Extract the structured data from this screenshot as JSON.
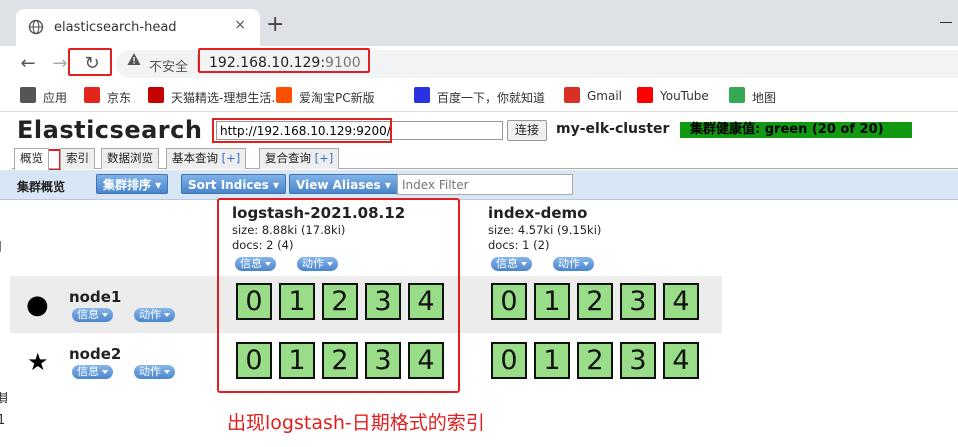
{
  "browser": {
    "tab_title": "elasticsearch-head",
    "tab_close": "×",
    "new_tab": "+",
    "back": "←",
    "forward": "→",
    "reload": "↻",
    "insecure_label": "不安全",
    "url_host": "192.168.10.129:",
    "url_port": "9100",
    "bookmarks": [
      {
        "label": "应用",
        "icon": "apps-grid-icon",
        "color": "#555555"
      },
      {
        "label": "京东",
        "icon": "jd-icon",
        "color": "#e1251b"
      },
      {
        "label": "天猫精选-理想生活...",
        "icon": "tmall-icon",
        "color": "#c40000"
      },
      {
        "label": "爱淘宝PC新版",
        "icon": "taobao-icon",
        "color": "#ff5000"
      },
      {
        "label": "百度一下，你就知道",
        "icon": "baidu-icon",
        "color": "#2932e1"
      },
      {
        "label": "Gmail",
        "icon": "gmail-icon",
        "color": "#d93025"
      },
      {
        "label": "YouTube",
        "icon": "youtube-icon",
        "color": "#ff0000"
      },
      {
        "label": "地图",
        "icon": "maps-icon",
        "color": "#34a853"
      }
    ]
  },
  "es": {
    "title": "Elasticsearch",
    "connect_url": "http://192.168.10.129:9200/",
    "connect_button": "连接",
    "cluster_name": "my-elk-cluster",
    "health": "集群健康值: green (20 of 20)",
    "health_color": "#119911",
    "tabs": [
      {
        "label": "概览",
        "plus": ""
      },
      {
        "label": "索引",
        "plus": ""
      },
      {
        "label": "数据浏览",
        "plus": ""
      },
      {
        "label": "基本查询",
        "plus": "[+]"
      },
      {
        "label": "复合查询",
        "plus": "[+]"
      }
    ],
    "toolbar": {
      "overview_label": "集群概览",
      "sort_cluster": "集群排序",
      "sort_indices": "Sort Indices",
      "view_aliases": "View Aliases",
      "index_filter_placeholder": "Index Filter"
    },
    "indices": [
      {
        "name": "logstash-2021.08.12",
        "size": "size: 8.88ki (17.8ki)",
        "docs": "docs: 2 (4)",
        "info": "信息",
        "action": "动作"
      },
      {
        "name": "index-demo",
        "size": "size: 4.57ki (9.15ki)",
        "docs": "docs: 1 (2)",
        "info": "信息",
        "action": "动作"
      }
    ],
    "nodes": [
      {
        "name": "node1",
        "icon": "circle-master-icon",
        "symbol": "●",
        "info": "信息",
        "action": "动作",
        "shards": [
          "0",
          "1",
          "2",
          "3",
          "4"
        ]
      },
      {
        "name": "node2",
        "icon": "star-node-icon",
        "symbol": "★",
        "info": "信息",
        "action": "动作",
        "shards": [
          "0",
          "1",
          "2",
          "3",
          "4"
        ]
      }
    ],
    "shard_color": "#99dd88"
  },
  "annotation": {
    "caption": "出现logstash-日期格式的索引"
  },
  "left_edge": [
    "J",
    "其",
    "1"
  ]
}
